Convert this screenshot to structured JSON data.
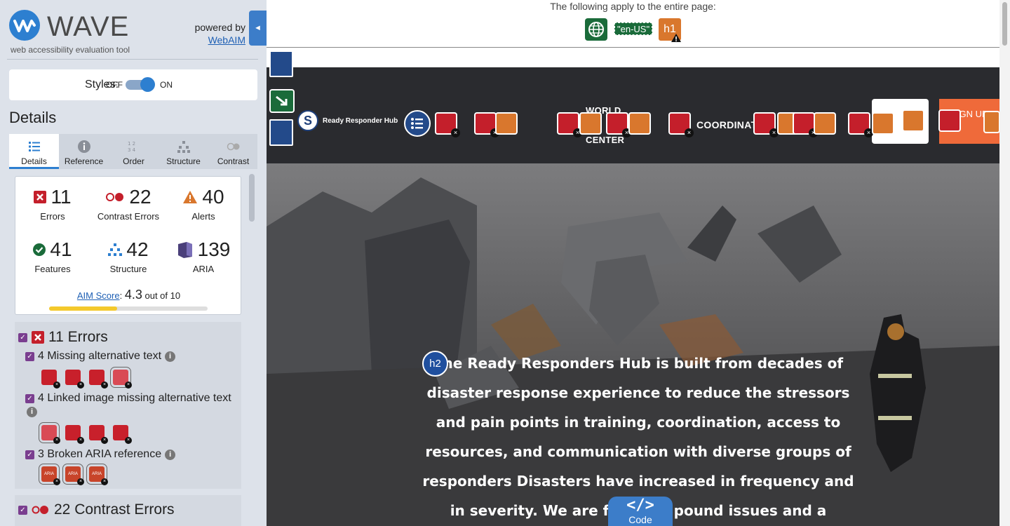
{
  "wave": {
    "brand": "WAVE",
    "tagline": "web accessibility evaluation tool",
    "powered_by": "powered by",
    "powered_link": "WebAIM",
    "collapse_glyph": "◄",
    "styles_label": "Styles:",
    "styles_off": "OFF",
    "styles_on": "ON",
    "details_title": "Details",
    "tabs": [
      {
        "label": "Details",
        "icon": "list-icon",
        "active": true
      },
      {
        "label": "Reference",
        "icon": "info-icon"
      },
      {
        "label": "Order",
        "icon": "order-icon"
      },
      {
        "label": "Structure",
        "icon": "structure-icon"
      },
      {
        "label": "Contrast",
        "icon": "contrast-icon"
      }
    ],
    "summary": {
      "errors": {
        "count": "11",
        "label": "Errors",
        "color": "#c41f2b"
      },
      "contrast": {
        "count": "22",
        "label": "Contrast Errors",
        "color": "#c41f2b"
      },
      "alerts": {
        "count": "40",
        "label": "Alerts",
        "color": "#d9772d"
      },
      "features": {
        "count": "41",
        "label": "Features",
        "color": "#1a6b3a"
      },
      "structure": {
        "count": "42",
        "label": "Structure",
        "color": "#2d7fd0"
      },
      "aria": {
        "count": "139",
        "label": "ARIA",
        "color": "#4a3f7a"
      }
    },
    "aim": {
      "link": "AIM Score",
      "colon": ":",
      "score": "4.3",
      "suffix": "out of 10",
      "fill": 0.43
    },
    "errors_panel": {
      "heading": "11 Errors",
      "items": [
        {
          "label": "4 Missing alternative text"
        },
        {
          "label": "4 Linked image missing alternative text"
        },
        {
          "label": "3 Broken ARIA reference"
        }
      ]
    },
    "contrast_panel": {
      "heading": "22 Contrast Errors"
    }
  },
  "page": {
    "apply_text": "The following apply to the entire page:",
    "lang": "\"en-US\"",
    "h1": "h1",
    "h2": "h2",
    "logo_text": "Ready Responder Hub",
    "nav": {
      "world": "WORLD",
      "center": "CENTER",
      "coordinat": "COORDINAT",
      "signup": "SIGN UP"
    },
    "hero_paragraph": "The Ready Responders Hub is built from decades of disaster response experience to reduce the stressors and pain points in training, coordination, access to resources, and communication with diverse groups of responders Disasters have increased in frequency and in severity. We are face    compound issues and a",
    "code_tab": {
      "symbol": "</>",
      "label": "Code"
    }
  }
}
